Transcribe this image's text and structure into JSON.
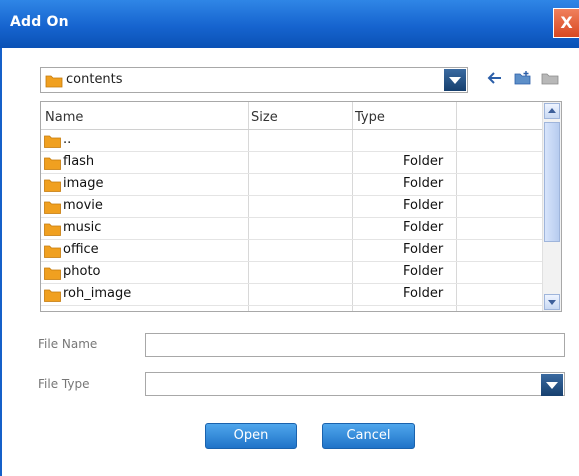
{
  "window": {
    "title": "Add On",
    "close_glyph": "X"
  },
  "path": {
    "current": "contents"
  },
  "toolbar": {
    "icons": [
      "back-arrow-icon",
      "new-folder-icon",
      "folder-icon"
    ]
  },
  "list": {
    "columns": [
      "Name",
      "Size",
      "Type"
    ],
    "rows": [
      {
        "name": "..",
        "size": "",
        "type": ""
      },
      {
        "name": "flash",
        "size": "",
        "type": "Folder"
      },
      {
        "name": "image",
        "size": "",
        "type": "Folder"
      },
      {
        "name": "movie",
        "size": "",
        "type": "Folder"
      },
      {
        "name": "music",
        "size": "",
        "type": "Folder"
      },
      {
        "name": "office",
        "size": "",
        "type": "Folder"
      },
      {
        "name": "photo",
        "size": "",
        "type": "Folder"
      },
      {
        "name": "roh_image",
        "size": "",
        "type": "Folder"
      }
    ]
  },
  "fields": {
    "file_name_label": "File Name",
    "file_name_value": "",
    "file_type_label": "File Type",
    "file_type_value": ""
  },
  "buttons": {
    "open": "Open",
    "cancel": "Cancel"
  },
  "colors": {
    "title_bar": "#1664cf",
    "button": "#2b86da",
    "folder": "#f0a020"
  }
}
